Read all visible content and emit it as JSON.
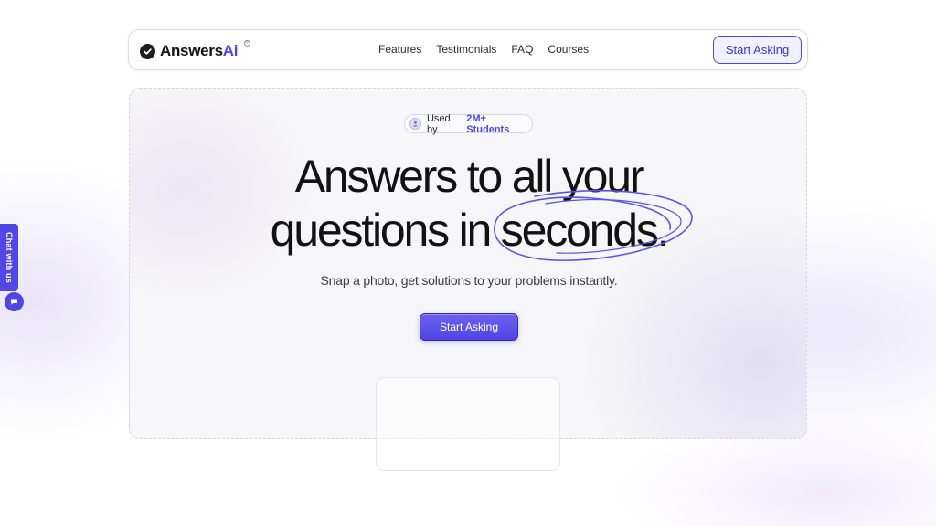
{
  "brand": {
    "name": "Answers",
    "name_accent": "Ai",
    "accent_color": "#4f46e5"
  },
  "nav": {
    "links": [
      "Features",
      "Testimonials",
      "FAQ",
      "Courses"
    ],
    "cta_label": "Start Asking"
  },
  "hero": {
    "badge_prefix": "Used by",
    "badge_highlight": "2M+ Students",
    "headline_line1": "Answers to all your",
    "headline_line2": "questions in seconds.",
    "subheadline": "Snap a photo, get solutions to your problems instantly.",
    "cta_label": "Start Asking"
  },
  "chat_widget": {
    "label": "Chat with us",
    "icon": "chat-bubble-icon"
  },
  "icons": {
    "logo": "check-circle-icon",
    "badge": "student-icon"
  }
}
